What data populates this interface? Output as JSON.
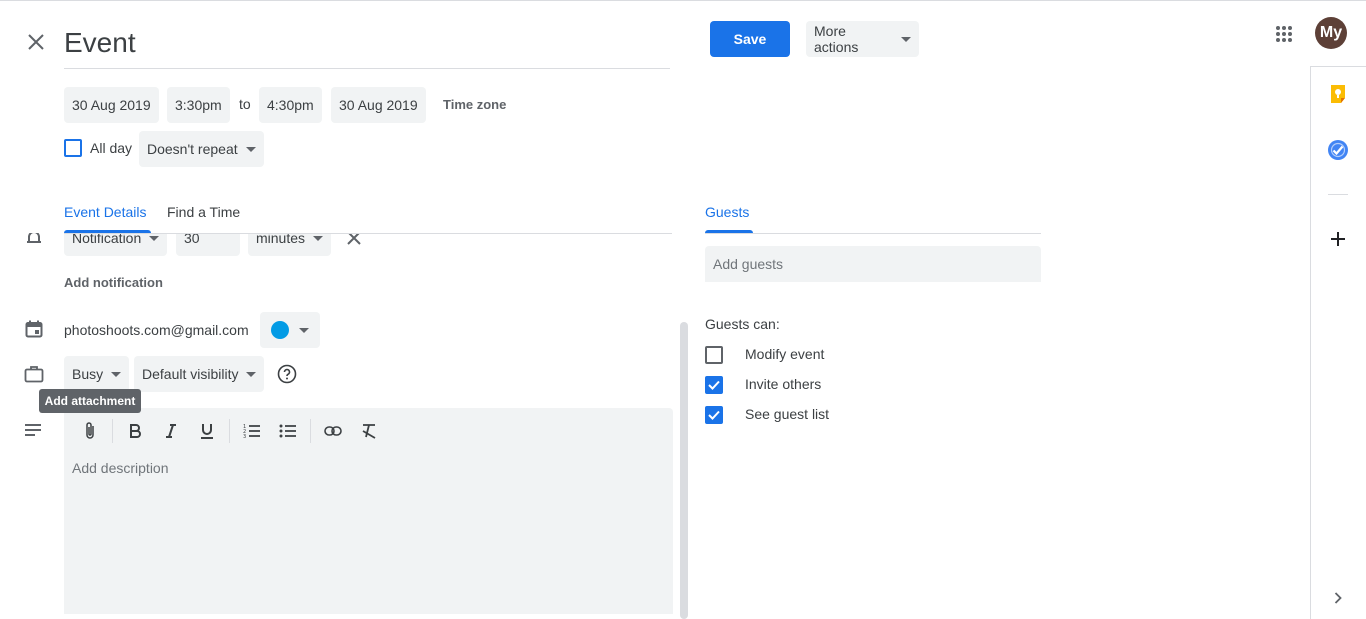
{
  "header": {
    "title": "Event",
    "save_label": "Save",
    "more_actions_label": "More actions",
    "avatar_initials": "My"
  },
  "datetime": {
    "start_date": "30 Aug 2019",
    "start_time": "3:30pm",
    "to_label": "to",
    "end_time": "4:30pm",
    "end_date": "30 Aug 2019",
    "time_zone_label": "Time zone",
    "all_day_label": "All day",
    "repeat_label": "Doesn't repeat"
  },
  "tabs": {
    "event_details": "Event Details",
    "find_a_time": "Find a Time",
    "guests": "Guests"
  },
  "notification": {
    "type": "Notification",
    "amount": "30",
    "unit": "minutes",
    "add_label": "Add notification"
  },
  "calendar": {
    "owner": "photoshoots.com@gmail.com",
    "color": "#039be5"
  },
  "status": {
    "busy_label": "Busy",
    "visibility_label": "Default visibility"
  },
  "tooltip": {
    "text": "Add attachment"
  },
  "description": {
    "placeholder": "Add description"
  },
  "guests": {
    "placeholder": "Add guests",
    "can_label": "Guests can:",
    "permissions": [
      {
        "label": "Modify event",
        "checked": false
      },
      {
        "label": "Invite others",
        "checked": true
      },
      {
        "label": "See guest list",
        "checked": true
      }
    ]
  },
  "colors": {
    "accent": "#1a73e8",
    "keep_yellow": "#fbbc04",
    "tasks_blue": "#4285f4",
    "avatar_bg": "#5d4037"
  },
  "icons": {
    "close": "close-icon",
    "apps": "apps-grid-icon",
    "keep": "keep-icon",
    "tasks": "tasks-icon",
    "add": "plus-icon",
    "expand": "chevron-right-icon"
  }
}
